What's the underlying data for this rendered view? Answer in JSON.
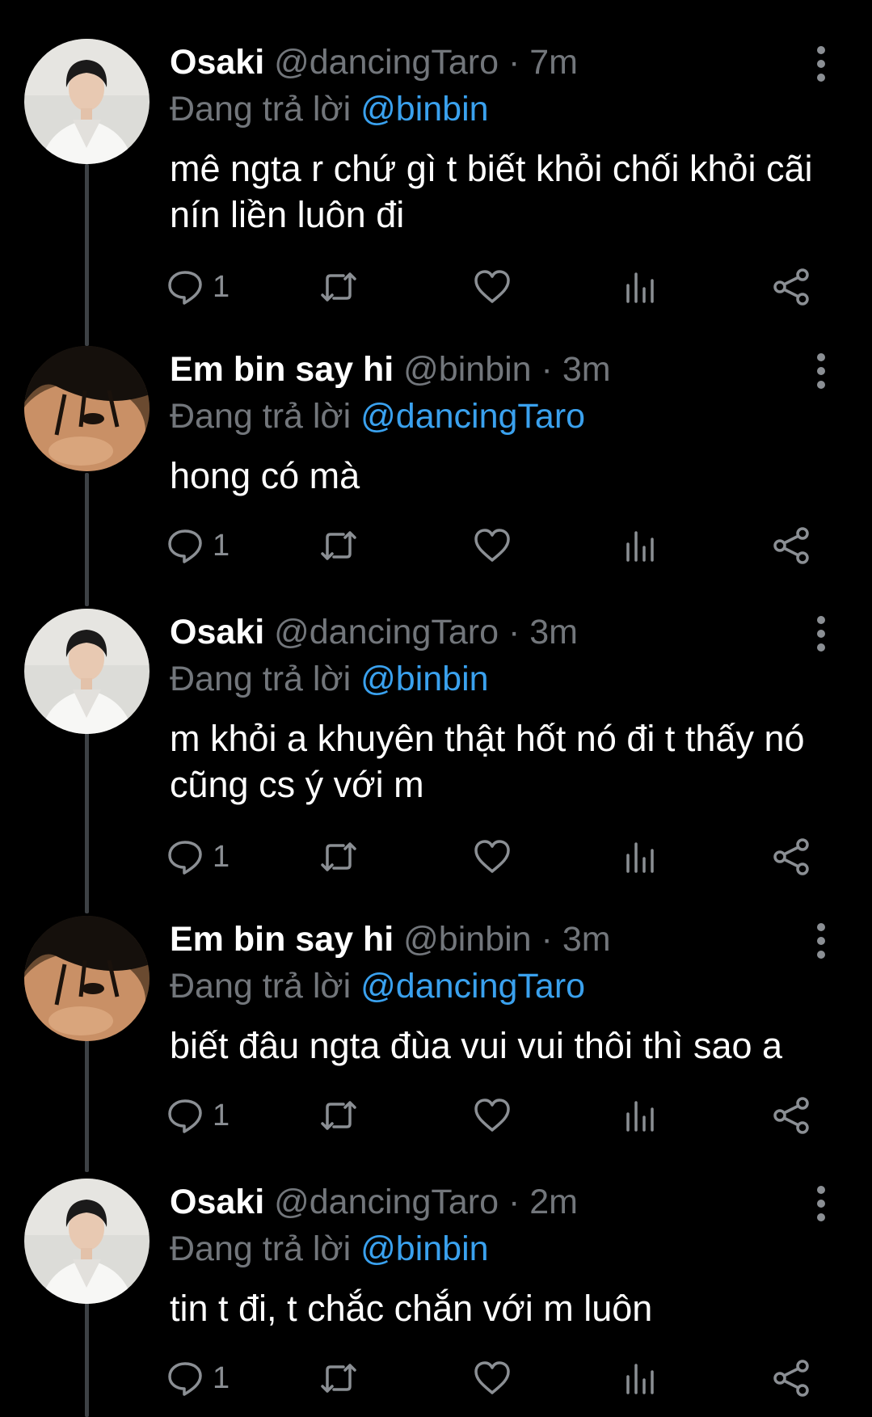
{
  "colors": {
    "background": "#000000",
    "text_primary": "#ffffff",
    "text_secondary": "#72767b",
    "link": "#3aa1ee",
    "icon": "#8b8f94",
    "thread_line": "#3d4145"
  },
  "icons": {
    "reply": "reply-icon",
    "retweet": "retweet-icon",
    "like": "like-icon",
    "views": "views-icon",
    "share": "share-icon",
    "more": "more-icon"
  },
  "tweets": [
    {
      "name": "Osaki",
      "handle": "@dancingTaro",
      "dot": "·",
      "time": "7m",
      "reply_prefix": "Đang trả lời",
      "reply_to": "@binbin",
      "text": "mê ngta r chứ gì t biết khỏi chối khỏi cãi nín liền luôn đi",
      "reply_count": "1"
    },
    {
      "name": "Em bin say hi",
      "handle": "@binbin",
      "dot": "·",
      "time": "3m",
      "reply_prefix": "Đang trả lời",
      "reply_to": "@dancingTaro",
      "text": "hong có mà",
      "reply_count": "1"
    },
    {
      "name": "Osaki",
      "handle": "@dancingTaro",
      "dot": "·",
      "time": "3m",
      "reply_prefix": "Đang trả lời",
      "reply_to": "@binbin",
      "text": "m khỏi a khuyên thật hốt nó đi t thấy nó cũng cs ý với m",
      "reply_count": "1"
    },
    {
      "name": "Em bin say hi",
      "handle": "@binbin",
      "dot": "·",
      "time": "3m",
      "reply_prefix": "Đang trả lời",
      "reply_to": "@dancingTaro",
      "text": "biết đâu ngta đùa vui vui thôi thì sao a",
      "reply_count": "1"
    },
    {
      "name": "Osaki",
      "handle": "@dancingTaro",
      "dot": "·",
      "time": "2m",
      "reply_prefix": "Đang trả lời",
      "reply_to": "@binbin",
      "text": "tin t đi, t chắc chắn với m luôn",
      "reply_count": "1"
    }
  ]
}
